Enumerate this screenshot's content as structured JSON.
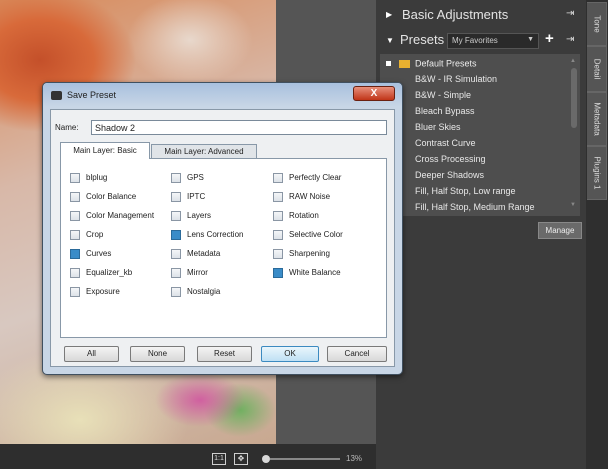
{
  "canvas": {
    "zoom_1to1": "1:1",
    "zoom_fit_glyph": "✥",
    "zoom_level": "13%"
  },
  "panel": {
    "basic_adjustments": "Basic Adjustments",
    "presets_title": "Presets",
    "preset_selected": "My Favorites",
    "add_glyph": "+",
    "pin_glyph": "⇥",
    "expand_glyph": "▶",
    "collapse_glyph": "▼",
    "dropdown_glyph": "▼",
    "folder_label": "Default Presets",
    "items": [
      "B&W - IR Simulation",
      "B&W - Simple",
      "Bleach Bypass",
      "Bluer Skies",
      "Contrast Curve",
      "Cross Processing",
      "Deeper Shadows",
      "Fill, Half Stop, Low range",
      "Fill, Half Stop, Medium Range"
    ],
    "manage_label": "Manage"
  },
  "side_tabs": [
    "Tone",
    "Detail",
    "Metadata",
    "Plugins 1"
  ],
  "dialog": {
    "title": "Save Preset",
    "close_glyph": "X",
    "name_label": "Name:",
    "name_value": "Shadow 2",
    "tab_basic": "Main Layer: Basic",
    "tab_advanced": "Main Layer: Advanced",
    "columns": [
      [
        {
          "label": "blplug",
          "checked": false
        },
        {
          "label": "Color Balance",
          "checked": false
        },
        {
          "label": "Color Management",
          "checked": false
        },
        {
          "label": "Crop",
          "checked": false
        },
        {
          "label": "Curves",
          "checked": true
        },
        {
          "label": "Equalizer_kb",
          "checked": false
        },
        {
          "label": "Exposure",
          "checked": false
        }
      ],
      [
        {
          "label": "GPS",
          "checked": false
        },
        {
          "label": "IPTC",
          "checked": false
        },
        {
          "label": "Layers",
          "checked": false
        },
        {
          "label": "Lens Correction",
          "checked": true
        },
        {
          "label": "Metadata",
          "checked": false
        },
        {
          "label": "Mirror",
          "checked": false
        },
        {
          "label": "Nostalgia",
          "checked": false
        }
      ],
      [
        {
          "label": "Perfectly Clear",
          "checked": false
        },
        {
          "label": "RAW Noise",
          "checked": false
        },
        {
          "label": "Rotation",
          "checked": false
        },
        {
          "label": "Selective Color",
          "checked": false
        },
        {
          "label": "Sharpening",
          "checked": false
        },
        {
          "label": "White Balance",
          "checked": true
        }
      ]
    ],
    "buttons": {
      "all": "All",
      "none": "None",
      "reset": "Reset",
      "ok": "OK",
      "cancel": "Cancel"
    }
  }
}
